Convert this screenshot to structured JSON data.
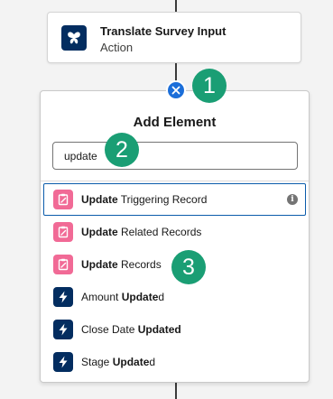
{
  "action_card": {
    "title": "Translate Survey Input",
    "subtitle": "Action",
    "icon": "butterfly-icon"
  },
  "close_button": {
    "icon": "close-icon"
  },
  "callouts": [
    "1",
    "2",
    "3"
  ],
  "panel": {
    "title": "Add Element",
    "search_value": "update",
    "results": [
      {
        "bold": "Update",
        "rest": " Triggering Record",
        "icon": "record-update-icon",
        "selected": true,
        "info_icon": "info-icon"
      },
      {
        "bold": "Update",
        "rest": " Related Records",
        "icon": "record-update-icon"
      },
      {
        "bold": "Update",
        "rest": " Records",
        "icon": "record-update-icon"
      },
      {
        "prefix": "Amount ",
        "bold": "Update",
        "rest": "d",
        "icon": "lightning-icon"
      },
      {
        "prefix": "Close Date ",
        "bold": "Updated",
        "rest": "",
        "icon": "lightning-icon"
      },
      {
        "prefix": "Stage ",
        "bold": "Update",
        "rest": "d",
        "icon": "lightning-icon"
      }
    ]
  },
  "colors": {
    "accent_blue": "#1b6ed9",
    "callout_green": "#1a9e74",
    "record_icon_pink": "#f16a96",
    "trigger_icon_navy": "#032d60"
  }
}
